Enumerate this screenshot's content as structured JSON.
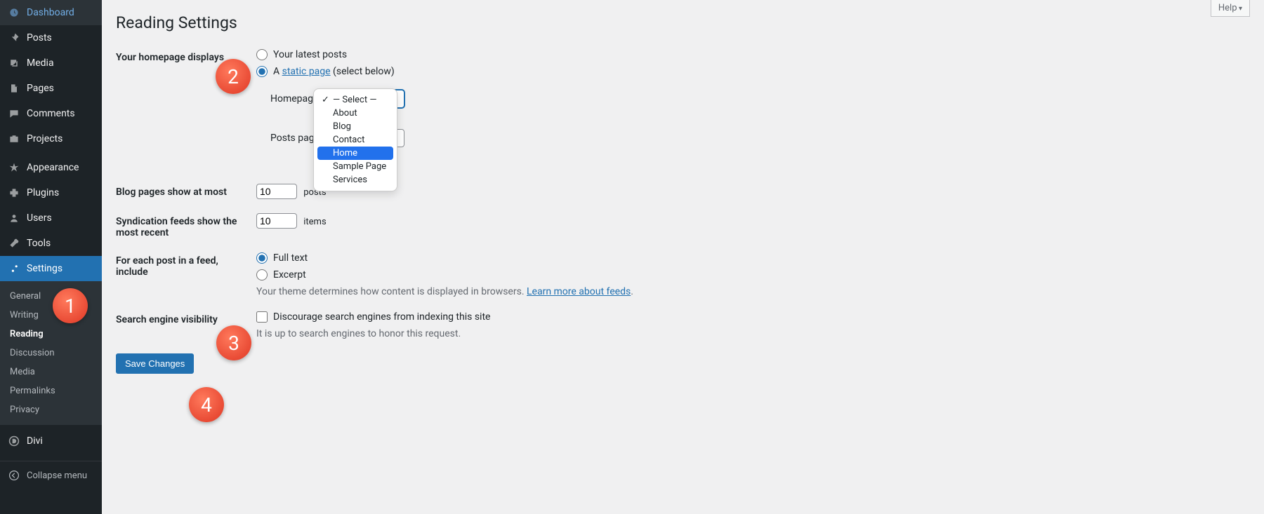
{
  "sidebar": {
    "items": [
      {
        "label": "Dashboard",
        "icon": "dashboard"
      },
      {
        "label": "Posts",
        "icon": "pin"
      },
      {
        "label": "Media",
        "icon": "media"
      },
      {
        "label": "Pages",
        "icon": "pages"
      },
      {
        "label": "Comments",
        "icon": "comment"
      },
      {
        "label": "Projects",
        "icon": "portfolio"
      }
    ],
    "items2": [
      {
        "label": "Appearance",
        "icon": "appearance"
      },
      {
        "label": "Plugins",
        "icon": "plugin"
      },
      {
        "label": "Users",
        "icon": "user"
      },
      {
        "label": "Tools",
        "icon": "tools"
      },
      {
        "label": "Settings",
        "icon": "settings",
        "active": true
      }
    ],
    "sub": [
      {
        "label": "General"
      },
      {
        "label": "Writing"
      },
      {
        "label": "Reading",
        "current": true
      },
      {
        "label": "Discussion"
      },
      {
        "label": "Media"
      },
      {
        "label": "Permalinks"
      },
      {
        "label": "Privacy"
      }
    ],
    "items3": [
      {
        "label": "Divi",
        "icon": "divi"
      }
    ],
    "collapse": "Collapse menu"
  },
  "help": "Help",
  "title": "Reading Settings",
  "homepage": {
    "label": "Your homepage displays",
    "opt_latest": "Your latest posts",
    "opt_static_prefix": "A ",
    "opt_static_link": "static page",
    "opt_static_suffix": " (select below)",
    "homepage_label": "Homepage:",
    "postspage_label": "Posts page:",
    "select_placeholder": "— Select —"
  },
  "dropdown": {
    "items": [
      {
        "label": "— Select —",
        "checked": true
      },
      {
        "label": "About"
      },
      {
        "label": "Blog"
      },
      {
        "label": "Contact"
      },
      {
        "label": "Home",
        "highlighted": true
      },
      {
        "label": "Sample Page"
      },
      {
        "label": "Services"
      }
    ]
  },
  "blog_pages": {
    "label": "Blog pages show at most",
    "value": "10",
    "suffix": "posts"
  },
  "syndication": {
    "label": "Syndication feeds show the most recent",
    "value": "10",
    "suffix": "items"
  },
  "feed": {
    "label": "For each post in a feed, include",
    "full": "Full text",
    "excerpt": "Excerpt",
    "desc_pre": "Your theme determines how content is displayed in browsers. ",
    "desc_link": "Learn more about feeds",
    "desc_post": "."
  },
  "search": {
    "label": "Search engine visibility",
    "check": "Discourage search engines from indexing this site",
    "desc": "It is up to search engines to honor this request."
  },
  "save": "Save Changes",
  "annotations": {
    "1": "1",
    "2": "2",
    "3": "3",
    "4": "4"
  }
}
